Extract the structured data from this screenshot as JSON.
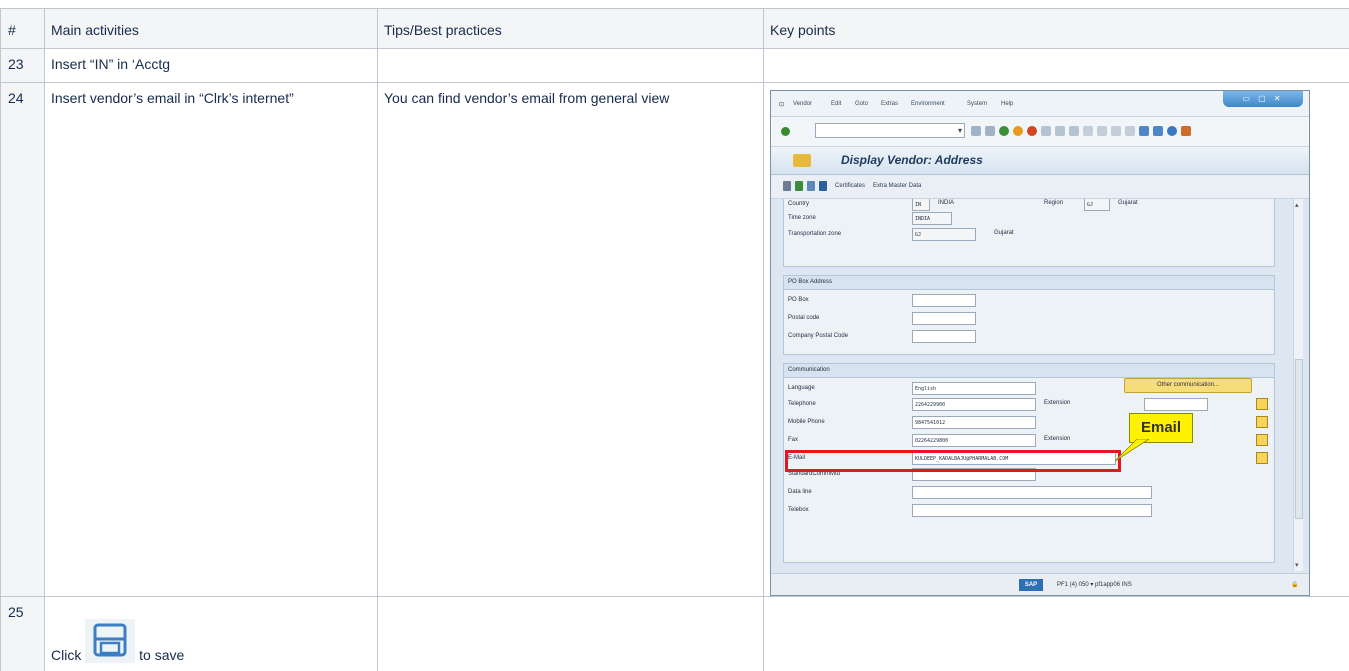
{
  "table": {
    "headers": [
      "#",
      "Main activities",
      "Tips/Best practices",
      "Key points"
    ],
    "rows": [
      {
        "num": "23",
        "activity": "Insert “IN” in ‘Acctg",
        "tip": "",
        "key": ""
      },
      {
        "num": "24",
        "activity": "Insert vendor’s email in “Clrk’s internet”",
        "tip": "You can find vendor’s email from general view",
        "key": ""
      },
      {
        "num": "25",
        "activity_before": "Click",
        "activity_after": "to save",
        "tip": "",
        "key": ""
      }
    ]
  },
  "sap": {
    "menu": [
      "Vendor",
      "Edit",
      "Goto",
      "Extras",
      "Environment",
      "System",
      "Help"
    ],
    "title": "Display Vendor: Address",
    "toolbar": [
      "Certificates",
      "Extra Master Data"
    ],
    "fields_top": {
      "country_label": "Country",
      "country_code": "IN",
      "country_name": "INDIA",
      "region_label": "Region",
      "region_code": "GJ",
      "region_name": "Gujarat",
      "timezone_label": "Time zone",
      "timezone_value": "INDIA",
      "transport_label": "Transportation zone",
      "transport_value": "GJ",
      "transport_name": "Gujarat"
    },
    "pobox": {
      "header": "PO Box Address",
      "labels": [
        "PO Box",
        "Postal code",
        "Company Postal Code"
      ]
    },
    "communication": {
      "header": "Communication",
      "language_label": "Language",
      "language_value": "English",
      "other_button": "Other communication...",
      "telephone_label": "Telephone",
      "telephone_value": "2264229900",
      "extension_label": "Extension",
      "mobile_label": "Mobile Phone",
      "mobile_value": "9847541012",
      "fax_label": "Fax",
      "fax_value": "02264229800",
      "fax_ext_label": "Extension",
      "email_label": "E-Mail",
      "email_value": "KULDEEP_KADALBAJU@PHARMALAB.COM",
      "stdcomm_label": "StandardCommMtd",
      "dataline_label": "Data line",
      "telebox_label": "Telebox"
    },
    "callout": "Email",
    "status": {
      "logo": "SAP",
      "text": "PF1 (4) 050 ▾  pf1app06  INS"
    },
    "colors": {
      "highlight": "#e8141e",
      "callout": "#fff200"
    }
  }
}
